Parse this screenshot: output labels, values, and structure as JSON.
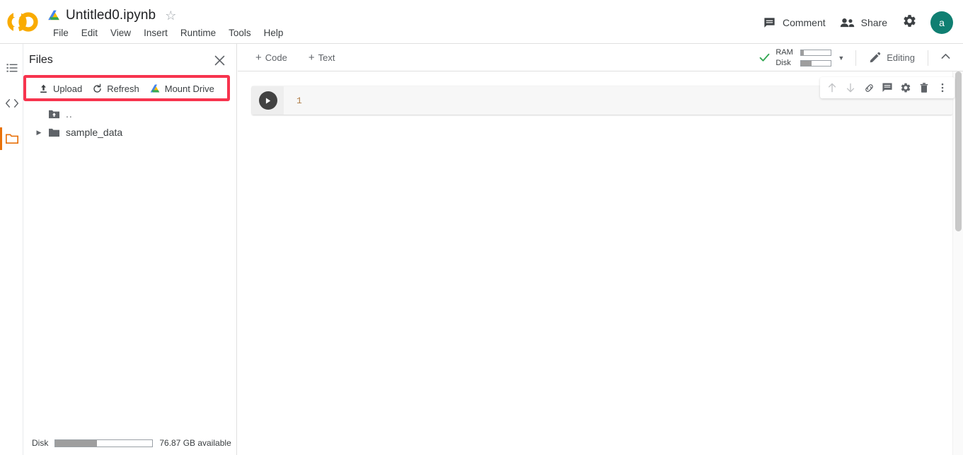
{
  "header": {
    "logo_icon": "colab-logo",
    "drive_icon": "google-drive-icon",
    "notebook_title": "Untitled0.ipynb",
    "star_icon": "star-outline-icon",
    "menu_items": [
      "File",
      "Edit",
      "View",
      "Insert",
      "Runtime",
      "Tools",
      "Help"
    ],
    "comment_label": "Comment",
    "comment_icon": "comment-icon",
    "share_label": "Share",
    "share_icon": "people-icon",
    "settings_icon": "gear-icon",
    "avatar_initial": "a",
    "avatar_color": "#107f72"
  },
  "rail": {
    "items": [
      {
        "name": "table-of-contents",
        "icon": "list-icon",
        "active": false
      },
      {
        "name": "code-snippets",
        "icon": "code-brackets-icon",
        "active": false
      },
      {
        "name": "files",
        "icon": "folder-icon",
        "active": true
      }
    ],
    "active_color": "#e8710a"
  },
  "sidebar": {
    "title": "Files",
    "close_icon": "close-icon",
    "toolbar": {
      "highlighted": true,
      "highlight_color": "#f7344e",
      "buttons": [
        {
          "label": "Upload",
          "icon": "upload-icon"
        },
        {
          "label": "Refresh",
          "icon": "refresh-icon"
        },
        {
          "label": "Mount Drive",
          "icon": "google-drive-icon"
        }
      ]
    },
    "tree": [
      {
        "label": "..",
        "icon": "folder-up-icon",
        "has_caret": false
      },
      {
        "label": "sample_data",
        "icon": "folder-icon",
        "has_caret": true
      }
    ],
    "disk_status": {
      "label": "Disk",
      "fill_percent": 43,
      "text": "76.87 GB available"
    }
  },
  "notebook_toolbar": {
    "add_code_label": "Code",
    "add_text_label": "Text",
    "plus_glyph": "+",
    "resources": {
      "status_icon": "check-icon",
      "status_color": "#34a853",
      "ram_label": "RAM",
      "ram_percent": 9,
      "disk_label": "Disk",
      "disk_percent": 34,
      "dropdown_icon": "caret-down-icon"
    },
    "editing_label": "Editing",
    "editing_icon": "pencil-icon",
    "collapse_icon": "chevron-up-icon"
  },
  "notebook": {
    "cell": {
      "run_icon": "play-icon",
      "line_number": "1",
      "code": "",
      "tools": [
        {
          "name": "move-cell-up-button",
          "icon": "arrow-up-icon",
          "disabled": true
        },
        {
          "name": "move-cell-down-button",
          "icon": "arrow-down-icon",
          "disabled": true
        },
        {
          "name": "link-to-cell-button",
          "icon": "link-icon",
          "disabled": false
        },
        {
          "name": "add-comment-button",
          "icon": "comment-icon",
          "disabled": false
        },
        {
          "name": "cell-settings-button",
          "icon": "gear-icon",
          "disabled": false
        },
        {
          "name": "delete-cell-button",
          "icon": "trash-icon",
          "disabled": false
        },
        {
          "name": "more-cell-actions-button",
          "icon": "kebab-menu-icon",
          "disabled": false
        }
      ]
    }
  }
}
